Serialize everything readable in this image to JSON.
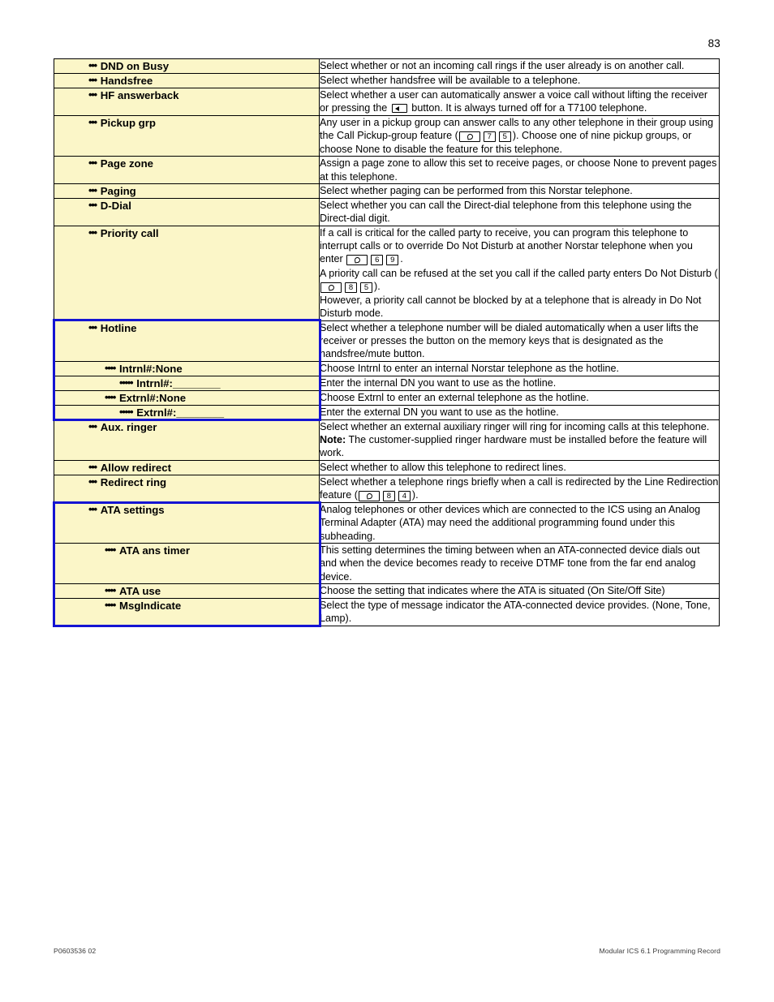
{
  "page": {
    "number": "83",
    "footer_left": "P0603536   02",
    "footer_right": "Modular ICS 6.1 Programming Record"
  },
  "colors": {
    "label_background": "#FBF6C8",
    "highlight_border": "#1414D2",
    "text": "#000000"
  },
  "rows": [
    {
      "level": 3,
      "bullet": "•••",
      "label": "DND on Busy",
      "desc": "Select whether or not an incoming call rings if the user already is on another call."
    },
    {
      "level": 3,
      "bullet": "•••",
      "label": "Handsfree",
      "desc": "Select whether handsfree will be available to a telephone."
    },
    {
      "level": 3,
      "bullet": "•••",
      "label": "HF answerback",
      "desc_part1": "Select whether a user can automatically answer a voice call without lifting the receiver or pressing the ",
      "desc_part2": " button. It is always turned off for a T7100 telephone.",
      "inline_icon": "handsfree-mute-button-icon"
    },
    {
      "level": 3,
      "bullet": "•••",
      "label": "Pickup grp",
      "desc_part1": "Any user in a pickup group can answer calls to any other telephone in their group using the Call Pickup-group feature (",
      "feature_keys": [
        "FEATURE",
        "7",
        "5"
      ],
      "desc_part2": "). Choose one of nine pickup groups, or choose None to disable the feature for this telephone."
    },
    {
      "level": 3,
      "bullet": "•••",
      "label": "Page zone",
      "desc": "Assign a page zone to allow this set to receive pages, or choose None to prevent pages at this telephone."
    },
    {
      "level": 3,
      "bullet": "•••",
      "label": "Paging",
      "desc": "Select whether paging can be performed from this Norstar telephone."
    },
    {
      "level": 3,
      "bullet": "•••",
      "label": "D-Dial",
      "desc": "Select whether you can call the Direct-dial telephone from this telephone using the Direct-dial digit."
    },
    {
      "level": 3,
      "bullet": "•••",
      "label": "Priority call",
      "desc_line1a": "If a call is critical for the called party to receive, you can program this telephone to interrupt calls or to override Do Not Disturb at another Norstar telephone when you enter ",
      "feature_keys_1": [
        "FEATURE",
        "6",
        "9"
      ],
      "desc_line1b": ".",
      "desc_line2a": "A priority call can be refused at the set you call if the called party enters Do Not Disturb (",
      "feature_keys_2": [
        "FEATURE",
        "8",
        "5"
      ],
      "desc_line2b": ").",
      "desc_line3": "However, a priority call cannot be blocked by at a telephone that is already in Do Not Disturb mode."
    },
    {
      "level": 3,
      "bullet": "•••",
      "label": "Hotline",
      "desc": "Select whether a telephone number will be dialed automatically when a user lifts the receiver or presses the button on the memory keys that is designated as the handsfree/mute button.",
      "group": "hotline"
    },
    {
      "level": 4,
      "bullet": "••••",
      "label": "Intrnl#:None",
      "desc": "Choose Intrnl to enter an internal Norstar telephone as the hotline.",
      "group": "hotline"
    },
    {
      "level": 5,
      "bullet": "•••••",
      "label": "Intrnl#:________",
      "desc": "Enter the internal DN you want to use as the hotline.",
      "group": "hotline"
    },
    {
      "level": 4,
      "bullet": "••••",
      "label": "Extrnl#:None",
      "desc": "Choose Extrnl to enter an external telephone as the hotline.",
      "group": "hotline"
    },
    {
      "level": 5,
      "bullet": "•••••",
      "label": "Extrnl#:________",
      "desc": "Enter the external DN you want to use as the hotline.",
      "group": "hotline"
    },
    {
      "level": 3,
      "bullet": "•••",
      "label": "Aux. ringer",
      "desc_line1": "Select whether an external auxiliary ringer will ring for incoming calls at this telephone.",
      "note_label": "Note:",
      "note_text": " The customer-supplied ringer hardware must be installed before the feature will work."
    },
    {
      "level": 3,
      "bullet": "•••",
      "label": "Allow redirect",
      "desc": "Select whether to allow this telephone to redirect lines."
    },
    {
      "level": 3,
      "bullet": "•••",
      "label": "Redirect ring",
      "desc_part1": "Select whether a telephone rings briefly when a call is redirected by the Line Redirection feature (",
      "feature_keys": [
        "FEATURE",
        "8",
        "4"
      ],
      "desc_part2": ")."
    },
    {
      "level": 3,
      "bullet": "•••",
      "label": "ATA settings",
      "desc": "Analog telephones or other devices which are connected to the ICS using an Analog Terminal Adapter (ATA) may need the additional programming found under this subheading.",
      "group": "ata"
    },
    {
      "level": 4,
      "bullet": "••••",
      "label": "ATA ans timer",
      "desc": "This setting determines the timing between when an ATA-connected device dials out and when the device becomes ready to receive DTMF tone from the far end analog device.",
      "group": "ata"
    },
    {
      "level": 4,
      "bullet": "••••",
      "label": "ATA use",
      "desc": "Choose the setting that indicates where the ATA is situated (On Site/Off Site)",
      "group": "ata"
    },
    {
      "level": 4,
      "bullet": "••••",
      "label": "MsgIndicate",
      "desc": "Select the type of message indicator the ATA-connected device provides. (None, Tone, Lamp).",
      "group": "ata"
    }
  ]
}
